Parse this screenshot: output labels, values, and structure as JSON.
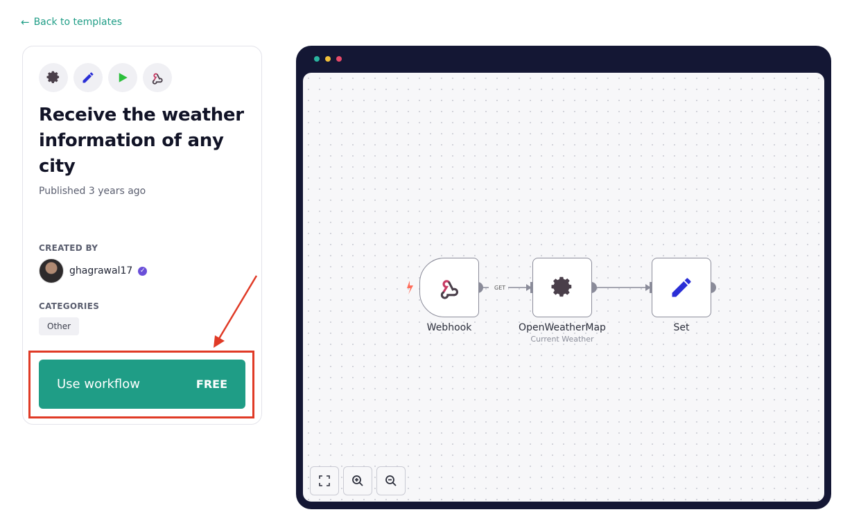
{
  "back_link": {
    "label": "Back to templates"
  },
  "template": {
    "title": "Receive the weather information of any city",
    "published": "Published 3 years ago",
    "node_icons": [
      "gear-icon",
      "pencil-icon",
      "play-icon",
      "webhook-icon"
    ],
    "created_by_label": "CREATED BY",
    "creator": {
      "username": "ghagrawal17",
      "verified": true
    },
    "categories_label": "CATEGORIES",
    "categories": [
      "Other"
    ],
    "cta": {
      "label": "Use workflow",
      "price": "FREE"
    }
  },
  "window_dots": [
    "#2bb5a0",
    "#f2c13a",
    "#e84a6a"
  ],
  "workflow": {
    "nodes": [
      {
        "name": "Webhook",
        "subtitle": "",
        "icon": "webhook-icon"
      },
      {
        "name": "OpenWeatherMap",
        "subtitle": "Current Weather",
        "icon": "gear-icon"
      },
      {
        "name": "Set",
        "subtitle": "",
        "icon": "pencil-icon"
      }
    ],
    "edge_label": "GET"
  },
  "controls": [
    "fit-view-icon",
    "zoom-in-icon",
    "zoom-out-icon"
  ],
  "colors": {
    "accent": "#1f9d86",
    "highlight": "#e03a26",
    "frame": "#141734"
  }
}
